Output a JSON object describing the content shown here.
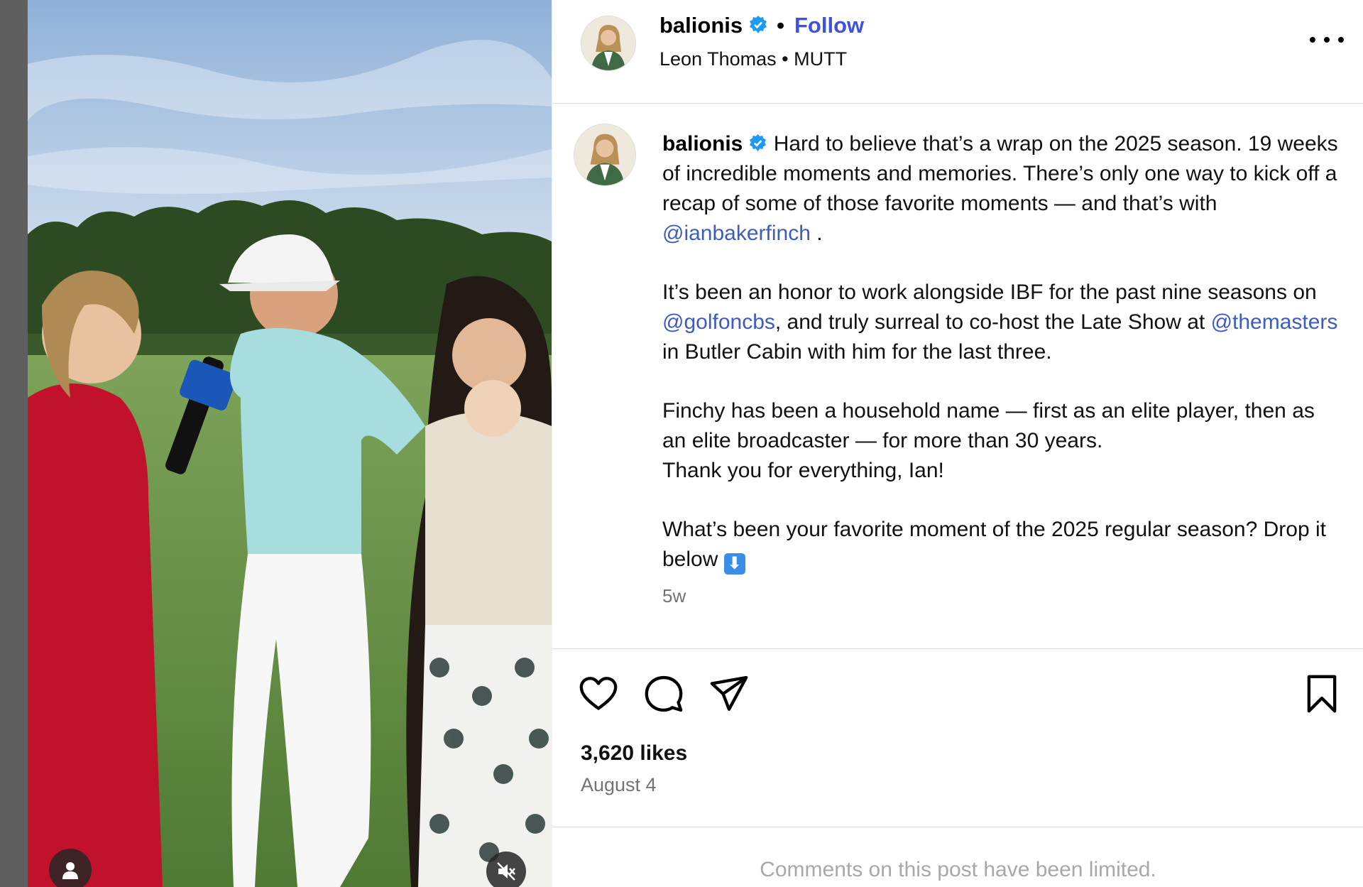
{
  "post": {
    "media_alt": "Interview on the golf course at sunset",
    "media_icons": {
      "user_tags": "user-tag-icon",
      "mute": "muted-speaker-icon"
    }
  },
  "header": {
    "username": "balionis",
    "verified_icon": "verified-badge-icon",
    "separator": "•",
    "follow_label": "Follow",
    "audio_artist": "Leon Thomas",
    "audio_separator": "•",
    "audio_track": "MUTT",
    "more_icon": "more-options-icon"
  },
  "caption": {
    "username": "balionis",
    "p1_text": "Hard to believe that’s a wrap on the 2025 season. 19 weeks of incredible moments and memories. There’s only one way to kick off a recap of some of those favorite moments — and that’s with ",
    "p1_mention": "@ianbakerfinch",
    "p1_end": " .",
    "p2_a": "It’s been an honor to work alongside IBF for the past nine seasons on ",
    "p2_mention1": "@golfoncbs",
    "p2_b": ", and truly surreal to co-host the Late Show at ",
    "p2_mention2": "@themasters",
    "p2_c": " in Butler Cabin with him for the last three.",
    "p3_line1": "Finchy has been a household name — first as an elite player, then as an elite broadcaster — for more than 30 years.",
    "p3_line2": "Thank you for everything, Ian!",
    "p4_text": "What’s been your favorite moment of the 2025 regular season? Drop it below ",
    "p4_emoji": "⬇",
    "time_ago": "5w"
  },
  "actions": {
    "like_icon": "heart-icon",
    "comment_icon": "comment-icon",
    "share_icon": "share-icon",
    "save_icon": "bookmark-icon",
    "likes": "3,620 likes",
    "date": "August 4"
  },
  "footer": {
    "comments_notice": "Comments on this post have been limited."
  },
  "colors": {
    "accent": "#3f51e5",
    "mention": "#3e5bbf",
    "verified": "#1d9bf0",
    "muted_text": "#737373",
    "divider": "#dbdbdb"
  }
}
